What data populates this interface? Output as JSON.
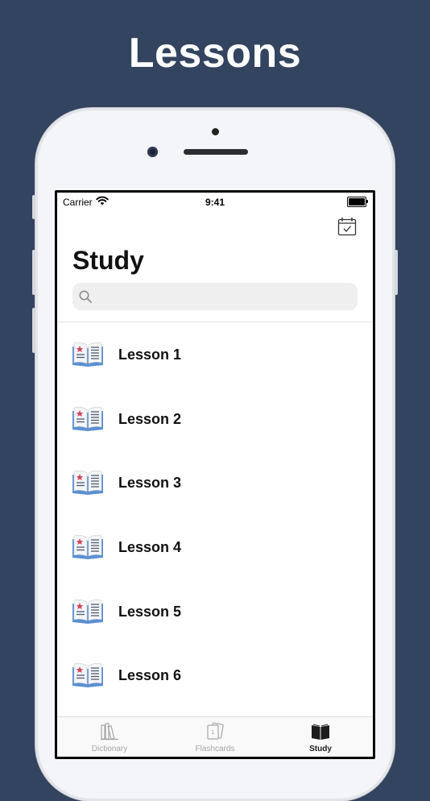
{
  "promo": {
    "headline": "Lessons"
  },
  "status_bar": {
    "carrier": "Carrier",
    "time": "9:41"
  },
  "header": {
    "title": "Study",
    "calendar_icon": "calendar-check-icon"
  },
  "search": {
    "placeholder": "",
    "value": ""
  },
  "lessons": [
    {
      "label": "Lesson 1",
      "icon": "open-book-icon"
    },
    {
      "label": "Lesson 2",
      "icon": "open-book-icon"
    },
    {
      "label": "Lesson 3",
      "icon": "open-book-icon"
    },
    {
      "label": "Lesson 4",
      "icon": "open-book-icon"
    },
    {
      "label": "Lesson 5",
      "icon": "open-book-icon"
    },
    {
      "label": "Lesson 6",
      "icon": "open-book-icon"
    }
  ],
  "tabs": [
    {
      "label": "Dictionary",
      "icon": "books-icon",
      "active": false
    },
    {
      "label": "Flashcards",
      "icon": "flashcards-icon",
      "active": false
    },
    {
      "label": "Study",
      "icon": "book-icon",
      "active": true
    }
  ],
  "colors": {
    "background": "#32445f",
    "accent_red": "#d9415a",
    "book_blue": "#5b8fd3"
  }
}
